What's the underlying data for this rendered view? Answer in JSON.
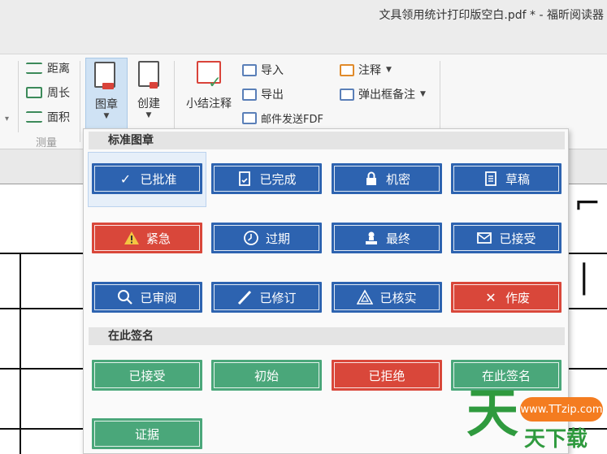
{
  "window": {
    "title": "文具领用统计打印版空白.pdf * - 福昕阅读器"
  },
  "ribbon": {
    "measure": {
      "items": [
        {
          "label": "距离",
          "icon": "ruler-distance-icon"
        },
        {
          "label": "周长",
          "icon": "perimeter-icon"
        },
        {
          "label": "面积",
          "icon": "area-icon"
        }
      ],
      "group_label": "测量"
    },
    "stamp_button": {
      "label": "图章",
      "icon": "stamp-icon"
    },
    "create_button": {
      "label": "创建",
      "icon": "create-stamp-icon"
    },
    "summary_button": {
      "label": "小结注释",
      "icon": "summarize-comments-icon"
    },
    "import_label": "导入",
    "export_label": "导出",
    "email_label": "邮件发送FDF",
    "comment_label": "注释",
    "popup_label": "弹出框备注"
  },
  "stamp_panel": {
    "standard_header": "标准图章",
    "standard_stamps": [
      {
        "label": "已批准",
        "color": "#2d63b0",
        "icon": "checkmark-icon"
      },
      {
        "label": "已完成",
        "color": "#2d63b0",
        "icon": "document-done-icon"
      },
      {
        "label": "机密",
        "color": "#2d63b0",
        "icon": "lock-icon"
      },
      {
        "label": "草稿",
        "color": "#2d63b0",
        "icon": "draft-document-icon"
      },
      {
        "label": "紧急",
        "color": "#d9473a",
        "icon": "warning-icon"
      },
      {
        "label": "过期",
        "color": "#2d63b0",
        "icon": "clock-icon"
      },
      {
        "label": "最终",
        "color": "#2d63b0",
        "icon": "person-stamp-icon"
      },
      {
        "label": "已接受",
        "color": "#2d63b0",
        "icon": "envelope-icon"
      },
      {
        "label": "已审阅",
        "color": "#2d63b0",
        "icon": "magnifier-icon"
      },
      {
        "label": "已修订",
        "color": "#2d63b0",
        "icon": "pen-icon"
      },
      {
        "label": "已核实",
        "color": "#2d63b0",
        "icon": "triangle-verify-icon"
      },
      {
        "label": "作废",
        "color": "#d9473a",
        "icon": "x-icon"
      }
    ],
    "sign_header": "在此签名",
    "sign_stamps": [
      {
        "label": "已接受",
        "color": "#4aa77a"
      },
      {
        "label": "初始",
        "color": "#4aa77a"
      },
      {
        "label": "已拒绝",
        "color": "#d9473a"
      },
      {
        "label": "在此签名",
        "color": "#4aa77a"
      },
      {
        "label": "证据",
        "color": "#4aa77a"
      }
    ]
  },
  "watermark": {
    "url": "www.TTzip.com",
    "big_char": "天",
    "text": "天下载"
  }
}
